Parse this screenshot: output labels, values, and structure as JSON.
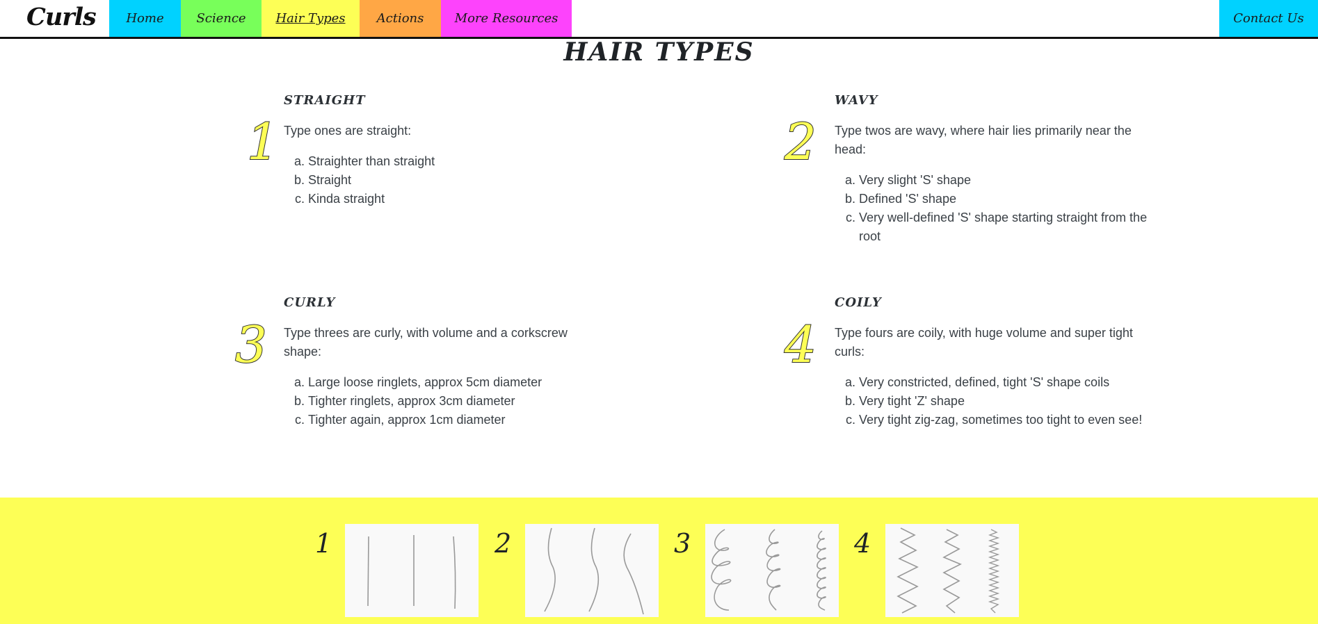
{
  "nav": {
    "brand": "Curls",
    "items": [
      {
        "label": "Home",
        "color": "#00d2ff"
      },
      {
        "label": "Science",
        "color": "#78ff5a"
      },
      {
        "label": "Hair Types",
        "color": "#fdff56",
        "active": true
      },
      {
        "label": "Actions",
        "color": "#ffa745"
      },
      {
        "label": "More Resources",
        "color": "#fd43fc"
      }
    ],
    "contact": {
      "label": "Contact Us",
      "color": "#00d2ff"
    }
  },
  "page": {
    "title": "HAIR TYPES"
  },
  "types": [
    {
      "number": "1",
      "heading": "STRAIGHT",
      "intro": "Type ones are straight:",
      "items": [
        {
          "marker": "a.",
          "text": "Straighter than straight"
        },
        {
          "marker": "b.",
          "text": "Straight"
        },
        {
          "marker": "c.",
          "text": "Kinda straight"
        }
      ]
    },
    {
      "number": "2",
      "heading": "WAVY",
      "intro": "Type twos are wavy, where hair lies primarily near the head:",
      "items": [
        {
          "marker": "a.",
          "text": "Very slight 'S' shape"
        },
        {
          "marker": "b.",
          "text": "Defined 'S' shape"
        },
        {
          "marker": "c.",
          "text": "Very well-defined 'S' shape starting straight from the root"
        }
      ]
    },
    {
      "number": "3",
      "heading": "CURLY",
      "intro": "Type threes are curly, with volume and a corkscrew shape:",
      "items": [
        {
          "marker": "a.",
          "text": "Large loose ringlets, approx 5cm diameter"
        },
        {
          "marker": "b.",
          "text": "Tighter ringlets, approx 3cm diameter"
        },
        {
          "marker": "c.",
          "text": "Tighter again, approx 1cm diameter"
        }
      ]
    },
    {
      "number": "4",
      "heading": "COILY",
      "intro": "Type fours are coily, with huge volume and super tight curls:",
      "items": [
        {
          "marker": "a.",
          "text": "Very constricted, defined, tight 'S' shape coils"
        },
        {
          "marker": "b.",
          "text": "Very tight 'Z' shape"
        },
        {
          "marker": "c.",
          "text": "Very tight zig-zag, sometimes too tight to even see!"
        }
      ]
    }
  ],
  "strip": {
    "background": "#fdff56",
    "labels": [
      "1",
      "2",
      "3",
      "4"
    ],
    "images": [
      "straight-hair-sketch",
      "wavy-hair-sketch",
      "curly-hair-sketch",
      "coily-hair-sketch"
    ]
  }
}
